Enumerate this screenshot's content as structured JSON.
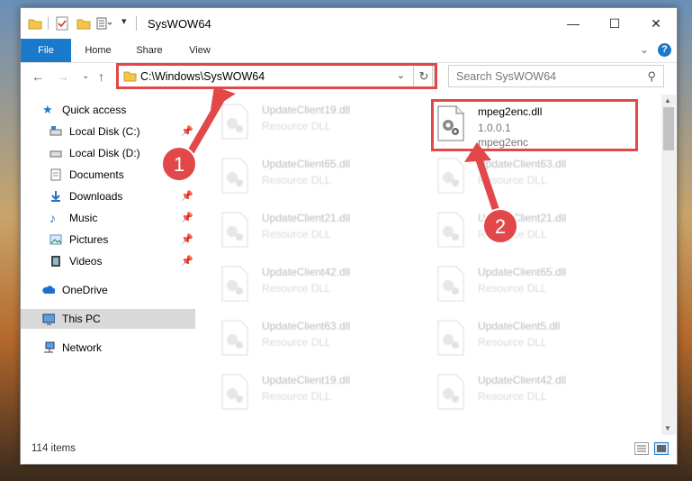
{
  "window": {
    "title": "SysWOW64",
    "controls": {
      "minimize": "—",
      "maximize": "☐",
      "close": "✕"
    }
  },
  "ribbon": {
    "tabs": [
      {
        "label": "File"
      },
      {
        "label": "Home"
      },
      {
        "label": "Share"
      },
      {
        "label": "View"
      }
    ],
    "collapse_glyph": "⌄",
    "help_glyph": "?"
  },
  "nav": {
    "back": "←",
    "forward": "→",
    "recent": "⌄",
    "up": "↑",
    "address": "C:\\Windows\\SysWOW64",
    "address_dropdown": "⌄",
    "refresh": "↻",
    "search_placeholder": "Search SysWOW64",
    "search_glyph": "⚲"
  },
  "sidebar": {
    "items": [
      {
        "label": "Quick access",
        "icon": "star-icon",
        "pinned": false
      },
      {
        "label": "Local Disk (C:)",
        "icon": "drive-icon",
        "pinned": true
      },
      {
        "label": "Local Disk (D:)",
        "icon": "drive-icon",
        "pinned": false
      },
      {
        "label": "Documents",
        "icon": "documents-icon",
        "pinned": false
      },
      {
        "label": "Downloads",
        "icon": "download-icon",
        "pinned": true
      },
      {
        "label": "Music",
        "icon": "music-icon",
        "pinned": true
      },
      {
        "label": "Pictures",
        "icon": "pictures-icon",
        "pinned": true
      },
      {
        "label": "Videos",
        "icon": "videos-icon",
        "pinned": true
      },
      {
        "label": "OneDrive",
        "icon": "cloud-icon",
        "pinned": false
      },
      {
        "label": "This PC",
        "icon": "computer-icon",
        "pinned": false,
        "selected": true
      },
      {
        "label": "Network",
        "icon": "network-icon",
        "pinned": false
      }
    ],
    "pin_glyph": "📌"
  },
  "files": {
    "left_column": [
      {
        "name": "UpdateClient19.dll",
        "desc": "Resource DLL"
      },
      {
        "name": "UpdateClient65.dll",
        "desc": "Resource DLL"
      },
      {
        "name": "UpdateClient21.dll",
        "desc": "Resource DLL"
      },
      {
        "name": "UpdateClient42.dll",
        "desc": "Resource DLL"
      },
      {
        "name": "UpdateClient63.dll",
        "desc": "Resource DLL"
      },
      {
        "name": "UpdateClient19.dll",
        "desc": "Resource DLL"
      }
    ],
    "selected": {
      "name": "mpeg2enc.dll",
      "version": "1.0.0.1",
      "desc": "mpeg2enc"
    },
    "right_column": [
      {
        "name": "UpdateClient63.dll",
        "desc": "Resource DLL"
      },
      {
        "name": "UpdateClient21.dll",
        "desc": "Resource DLL"
      },
      {
        "name": "UpdateClient65.dll",
        "desc": "Resource DLL"
      },
      {
        "name": "UpdateClient5.dll",
        "desc": "Resource DLL"
      },
      {
        "name": "UpdateClient42.dll",
        "desc": "Resource DLL"
      }
    ]
  },
  "annotations": {
    "step1": "1",
    "step2": "2",
    "color": "#e2484a"
  },
  "status": {
    "item_count": "114 items"
  }
}
